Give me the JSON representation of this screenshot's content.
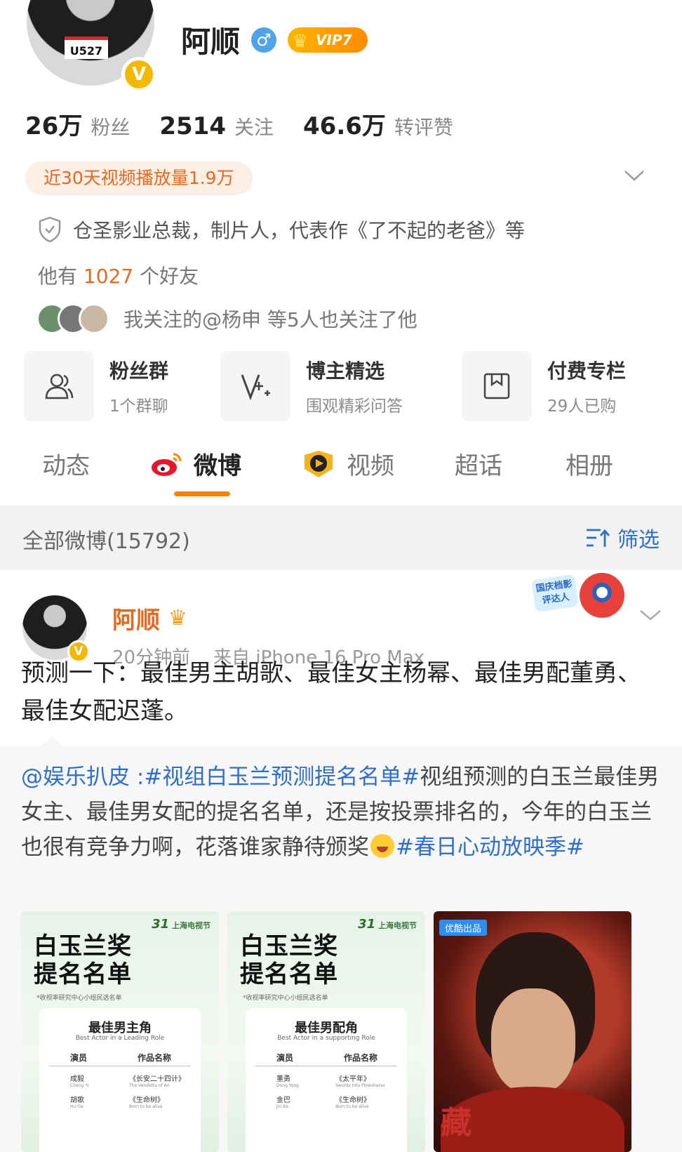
{
  "profile": {
    "name": "阿顺",
    "gender_symbol": "♂",
    "vip_label": "VIP7",
    "avatar_tag": "U527",
    "verified_mark": "V",
    "stats": [
      {
        "value": "26万",
        "label": "粉丝"
      },
      {
        "value": "2514",
        "label": "关注"
      },
      {
        "value": "46.6万",
        "label": "转评赞"
      }
    ],
    "video_plays": "近30天视频播放量1.9万",
    "certification": "仓圣影业总裁，制片人，代表作《了不起的老爸》等",
    "friends_prefix": "他有",
    "friends_count": "1027",
    "friends_suffix": "个好友",
    "mutual_follow": "我关注的@杨申 等5人也关注了他"
  },
  "features": [
    {
      "title": "粉丝群",
      "subtitle": "1个群聊",
      "icon": "group-icon"
    },
    {
      "title": "博主精选",
      "subtitle": "围观精彩问答",
      "icon": "featured-icon"
    },
    {
      "title": "付费专栏",
      "subtitle": "29人已购",
      "icon": "bookmark-icon"
    }
  ],
  "tabs": [
    {
      "label": "动态",
      "active": false
    },
    {
      "label": "微博",
      "active": true
    },
    {
      "label": "视频",
      "active": false
    },
    {
      "label": "超话",
      "active": false
    },
    {
      "label": "相册",
      "active": false
    }
  ],
  "filter": {
    "title": "全部微博(15792)",
    "button_label": "筛选"
  },
  "post": {
    "author": "阿顺",
    "time": "20分钟前",
    "source": "来自 iPhone 16 Pro Max",
    "sticker_text": "国庆档影评达人",
    "text": "预测一下：最佳男主胡歌、最佳女主杨幂、最佳男配董勇、最佳女配迟蓬。",
    "repost": {
      "mention": "@娱乐扒皮",
      "separator": " :",
      "topic1": "#视组白玉兰预测提名名单#",
      "body": "视组预测的白玉兰最佳男女主、最佳男女配的提名名单，还是按投票排名的，今年的白玉兰也很有竞争力啊，花落谁家静待颁奖",
      "topic2": "#春日心动放映季#"
    },
    "images": [
      {
        "festival_no": "31",
        "festival": "上海电视节",
        "title_line1": "白玉兰奖",
        "title_line2": "提名名单",
        "note": "*收视率研究中心小组民选名单",
        "category": "最佳男主角",
        "category_en": "Best Actor in a Leading Role",
        "col_actor": "演员",
        "col_work": "作品名称",
        "rows": [
          {
            "actor": "成毅",
            "actor_en": "Cheng Yi",
            "work": "《长安二十四计》",
            "work_en": "The Vendetta of An"
          },
          {
            "actor": "胡歌",
            "actor_en": "Hu Ge",
            "work": "《生命树》",
            "work_en": "Born to be alive"
          }
        ]
      },
      {
        "festival_no": "31",
        "festival": "上海电视节",
        "title_line1": "白玉兰奖",
        "title_line2": "提名名单",
        "note": "*收视率研究中心小组民选名单",
        "category": "最佳男配角",
        "category_en": "Best Actor in a supporting Role",
        "col_actor": "演员",
        "col_work": "作品名称",
        "rows": [
          {
            "actor": "董勇",
            "actor_en": "Dong Yong",
            "work": "《太平年》",
            "work_en": "Swords Into Plowshares"
          },
          {
            "actor": "金巴",
            "actor_en": "Jin Ba",
            "work": "《生命树》",
            "work_en": "Born to be alive"
          }
        ]
      },
      {
        "brand": "优酷出品",
        "glyph": "藏"
      }
    ]
  },
  "colors": {
    "accent": "#ff8200",
    "link": "#2f6fc7",
    "highlight": "#e36a23",
    "vip_gold": "#f5b800"
  }
}
